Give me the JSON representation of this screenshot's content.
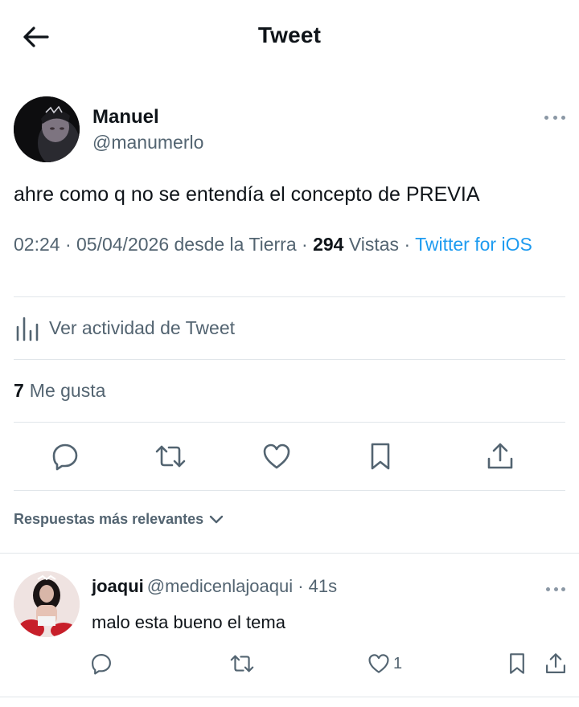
{
  "header": {
    "title": "Tweet",
    "back_icon": "arrow-left-icon"
  },
  "tweet": {
    "author_name": "Manuel",
    "author_handle": "@manumerlo",
    "text": "ahre como q no se entendía el concepto de PREVIA",
    "meta": {
      "time_date": "02:24 · 05/04/2026 desde la Tierra ·",
      "views_count": "294",
      "views_label": "Vistas ·",
      "source": "Twitter for iOS"
    },
    "activity_label": "Ver actividad de Tweet",
    "likes_count": "7",
    "likes_label": "Me gusta",
    "actions": [
      "reply-icon",
      "retweet-icon",
      "like-icon",
      "bookmark-icon",
      "share-icon"
    ]
  },
  "replies": {
    "sort_label": "Respuestas más relevantes",
    "items": [
      {
        "name": "joaqui",
        "handle_time": "@medicenlajoaqui · 41s",
        "text": "malo esta bueno el tema",
        "like_count": "1"
      }
    ]
  },
  "colors": {
    "text": "#0f1419",
    "secondary": "#536471",
    "link": "#1d9bf0",
    "divider": "#e1e6ea"
  }
}
